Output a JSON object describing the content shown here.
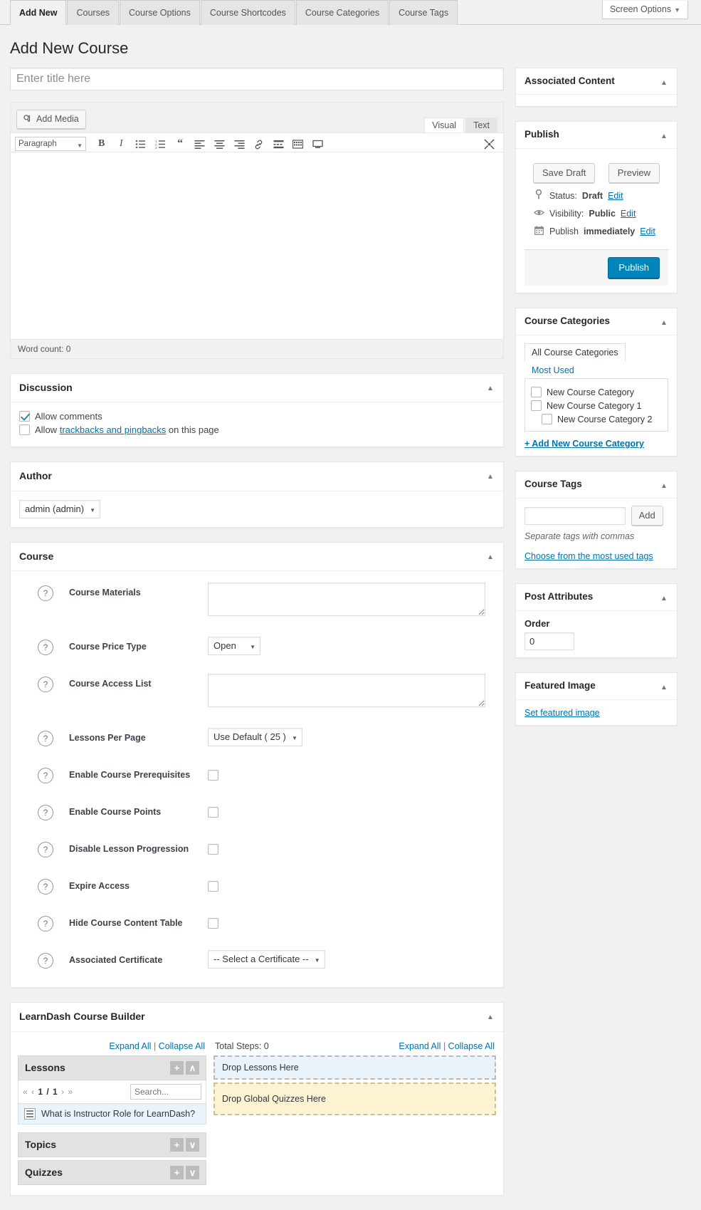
{
  "header": {
    "tabs": [
      {
        "label": "Add New",
        "active": true
      },
      {
        "label": "Courses",
        "active": false
      },
      {
        "label": "Course Options",
        "active": false
      },
      {
        "label": "Course Shortcodes",
        "active": false
      },
      {
        "label": "Course Categories",
        "active": false
      },
      {
        "label": "Course Tags",
        "active": false
      }
    ],
    "screen_options_label": "Screen Options",
    "caret": "▼"
  },
  "page_title": "Add New Course",
  "title_field": {
    "value": "",
    "placeholder": "Enter title here"
  },
  "editor": {
    "add_media_label": "Add Media",
    "tabs": [
      {
        "label": "Visual",
        "active": true
      },
      {
        "label": "Text",
        "active": false
      }
    ],
    "format_select": "Paragraph",
    "caret": "▼",
    "word_count_label": "Word count: 0",
    "content": ""
  },
  "discussion": {
    "title": "Discussion",
    "allow_comments_label": "Allow comments",
    "allow_comments_checked": true,
    "pingbacks_prefix": "Allow",
    "pingbacks_link": "trackbacks and pingbacks",
    "pingbacks_suffix": "on this page",
    "pingbacks_checked": false
  },
  "author": {
    "title": "Author",
    "selected": "admin (admin)"
  },
  "course": {
    "title": "Course",
    "rows": [
      {
        "label": "Course Materials",
        "type": "textarea",
        "value": ""
      },
      {
        "label": "Course Price Type",
        "type": "select",
        "value": "Open"
      },
      {
        "label": "Course Access List",
        "type": "textarea",
        "value": ""
      },
      {
        "label": "Lessons Per Page",
        "type": "select",
        "value": "Use Default ( 25 )"
      },
      {
        "label": "Enable Course Prerequisites",
        "type": "checkbox",
        "checked": false
      },
      {
        "label": "Enable Course Points",
        "type": "checkbox",
        "checked": false
      },
      {
        "label": "Disable Lesson Progression",
        "type": "checkbox",
        "checked": false
      },
      {
        "label": "Expire Access",
        "type": "checkbox",
        "checked": false
      },
      {
        "label": "Hide Course Content Table",
        "type": "checkbox",
        "checked": false
      },
      {
        "label": "Associated Certificate",
        "type": "select",
        "value": "-- Select a Certificate --"
      }
    ],
    "help_glyph": "?"
  },
  "builder": {
    "title": "LearnDash Course Builder",
    "left_expand": "Expand All",
    "left_collapse": "Collapse All",
    "right_expand": "Expand All",
    "right_collapse": "Collapse All",
    "separator": "|",
    "total_steps_label": "Total Steps: 0",
    "sections": [
      {
        "label": "Lessons",
        "add": "+",
        "toggle": "∧"
      },
      {
        "label": "Topics",
        "add": "+",
        "toggle": "∨"
      },
      {
        "label": "Quizzes",
        "add": "+",
        "toggle": "∨"
      }
    ],
    "pager": {
      "first": "«",
      "prev": "‹",
      "page": "1 / 1",
      "next": "›",
      "last": "»"
    },
    "search_placeholder": "Search...",
    "search_value": "",
    "lesson_items": [
      "What is Instructor Role for LearnDash?"
    ],
    "dropzones": [
      {
        "label": "Drop Lessons Here",
        "kind": "lessons"
      },
      {
        "label": "Drop Global Quizzes Here",
        "kind": "quizzes"
      }
    ]
  },
  "sidebar": {
    "associated_content": {
      "title": "Associated Content"
    },
    "publish": {
      "title": "Publish",
      "save_draft_label": "Save Draft",
      "preview_label": "Preview",
      "status_prefix": "Status:",
      "status_value": "Draft",
      "status_edit": "Edit",
      "visibility_prefix": "Visibility:",
      "visibility_value": "Public",
      "visibility_edit": "Edit",
      "publish_prefix": "Publish",
      "publish_value": "immediately",
      "publish_edit": "Edit",
      "publish_button": "Publish"
    },
    "categories": {
      "title": "Course Categories",
      "tab_all": "All Course Categories",
      "tab_most_used": "Most Used",
      "items": [
        {
          "label": "New Course Category",
          "checked": false,
          "child": false
        },
        {
          "label": "New Course Category 1",
          "checked": false,
          "child": false
        },
        {
          "label": "New Course Category 2",
          "checked": false,
          "child": true
        }
      ],
      "add_link": "+ Add New Course Category"
    },
    "tags": {
      "title": "Course Tags",
      "input_value": "",
      "add_label": "Add",
      "hint": "Separate tags with commas",
      "choose_link": "Choose from the most used tags"
    },
    "attributes": {
      "title": "Post Attributes",
      "order_label": "Order",
      "order_value": "0"
    },
    "featured": {
      "title": "Featured Image",
      "set_link": "Set featured image"
    },
    "collapse_glyph": "▲"
  },
  "colors": {
    "accent": "#0073aa",
    "publish_button": "#0085ba",
    "page_bg": "#f1f1f1",
    "lessons_dropzone": "#e9f3f9",
    "quizzes_dropzone": "#fbf3d2"
  }
}
